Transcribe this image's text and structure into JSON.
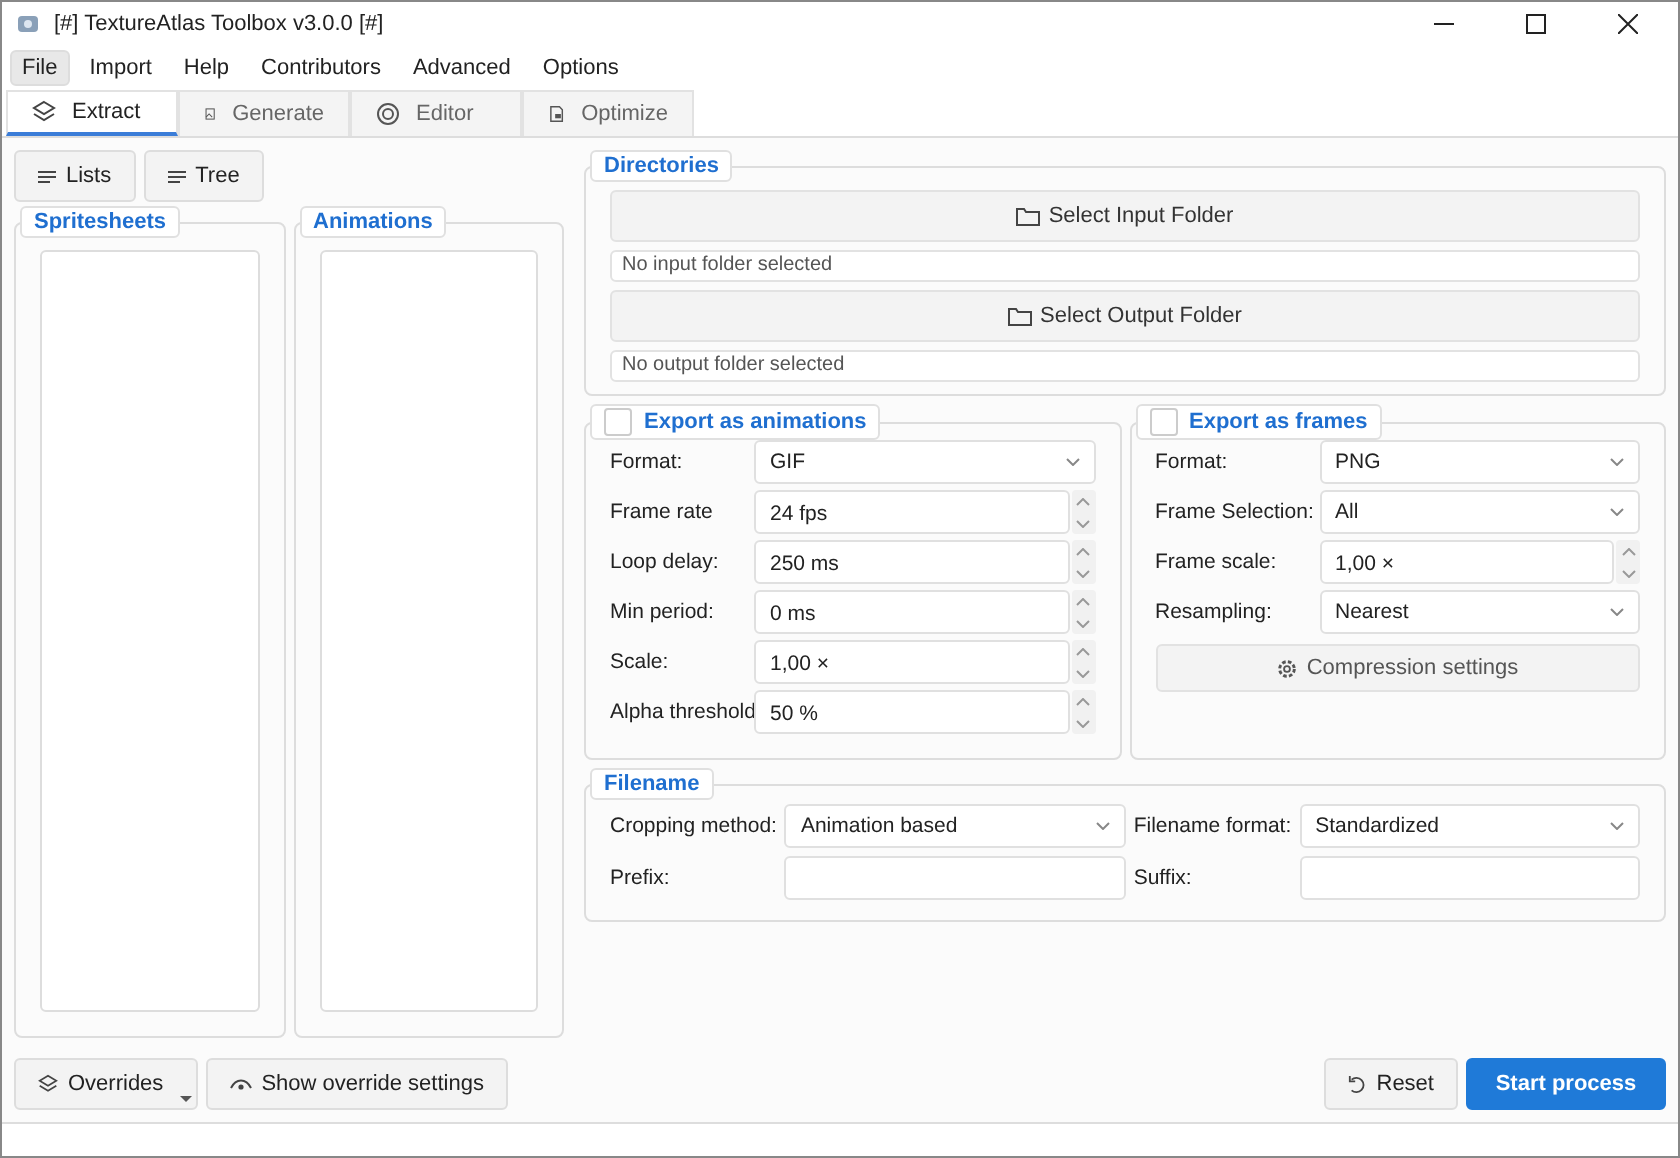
{
  "window": {
    "title": "[#] TextureAtlas Toolbox v3.0.0 [#]"
  },
  "menu": [
    {
      "label": "File",
      "selected": true
    },
    {
      "label": "Import",
      "selected": false
    },
    {
      "label": "Help",
      "selected": false
    },
    {
      "label": "Contributors",
      "selected": false
    },
    {
      "label": "Advanced",
      "selected": false
    },
    {
      "label": "Options",
      "selected": false
    }
  ],
  "tabs": [
    {
      "label": "Extract",
      "selected": true,
      "kind": "layers"
    },
    {
      "label": "Generate",
      "selected": false,
      "kind": "image"
    },
    {
      "label": "Editor",
      "selected": false,
      "kind": "target"
    },
    {
      "label": "Optimize",
      "selected": false,
      "kind": "file"
    }
  ],
  "view_buttons": [
    {
      "label": "Lists",
      "selected": false
    },
    {
      "label": "Tree",
      "selected": false
    }
  ],
  "lists": [
    {
      "title": "Spritesheets"
    },
    {
      "title": "Animations"
    }
  ],
  "directories": {
    "title": "Directories",
    "input_button": "Select Input Folder",
    "input_status": "No input folder selected",
    "output_button": "Select Output Folder",
    "output_status": "No output folder selected"
  },
  "export_animations": {
    "title": "Export as animations",
    "checked": false,
    "fields": [
      {
        "label": "Format:",
        "value": "GIF",
        "kind": "select"
      },
      {
        "label": "Frame rate",
        "value": "24 fps",
        "kind": "spin"
      },
      {
        "label": "Loop delay:",
        "value": "250 ms",
        "kind": "spin"
      },
      {
        "label": "Min period:",
        "value": "0 ms",
        "kind": "spin"
      },
      {
        "label": "Scale:",
        "value": "1,00 ×",
        "kind": "spin"
      },
      {
        "label": "Alpha threshold",
        "value": "50 %",
        "kind": "spin"
      }
    ]
  },
  "export_frames": {
    "title": "Export as frames",
    "checked": false,
    "fields": [
      {
        "label": "Format:",
        "value": "PNG",
        "kind": "select"
      },
      {
        "label": "Frame Selection:",
        "value": "All",
        "kind": "select"
      },
      {
        "label": "Frame scale:",
        "value": "1,00 ×",
        "kind": "spin"
      },
      {
        "label": "Resampling:",
        "value": "Nearest",
        "kind": "select"
      }
    ],
    "compression_button": "Compression settings"
  },
  "filename": {
    "title": "Filename",
    "fields": [
      {
        "label": "Cropping method:",
        "value": "Animation based",
        "kind": "select"
      },
      {
        "label": "Filename format:",
        "value": "Standardized",
        "kind": "select"
      },
      {
        "label": "Prefix:",
        "kind": "text"
      },
      {
        "label": "Suffix:",
        "kind": "text"
      }
    ]
  },
  "bottom": {
    "overrides": "Overrides",
    "show_overrides": "Show override settings",
    "reset": "Reset",
    "start": "Start process"
  }
}
